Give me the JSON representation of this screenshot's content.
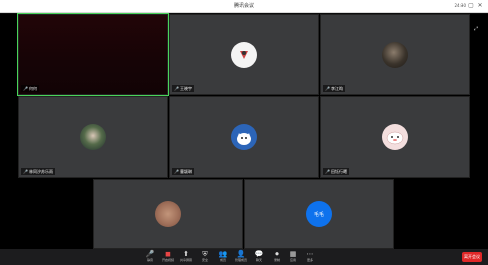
{
  "window": {
    "title": "腾讯会议",
    "time": "24:30",
    "controls": [
      "minimize-icon",
      "maximize-icon",
      "close-icon"
    ]
  },
  "top_right": {
    "view_label": "宫格视图",
    "buttons": [
      "layout-icon",
      "fullscreen-icon"
    ]
  },
  "participants": [
    {
      "name": "何何",
      "mic": "on",
      "avatar": "video",
      "speaking": true
    },
    {
      "name": "王晓宇",
      "mic": "on",
      "avatar": "white-logo"
    },
    {
      "name": "李江昀",
      "mic": "on",
      "avatar": "dark-photo"
    },
    {
      "name": "林同汐苏乐雨",
      "mic": "on",
      "avatar": "green-photo"
    },
    {
      "name": "曹颖琳",
      "mic": "on",
      "avatar": "blue-cartoon"
    },
    {
      "name": "田钰行曦",
      "mic": "off",
      "avatar": "pink-cartoon"
    },
    {
      "name": "",
      "mic": "on",
      "avatar": "tan-photo"
    },
    {
      "name": "",
      "mic": "on",
      "avatar": "initials",
      "initials": "毛毛"
    }
  ],
  "toolbar": {
    "buttons": [
      {
        "icon": "microphone-icon",
        "label": "静音"
      },
      {
        "icon": "camera-icon",
        "label": "开启视频"
      },
      {
        "icon": "share-screen-icon",
        "label": "共享屏幕"
      },
      {
        "icon": "security-icon",
        "label": "安全"
      },
      {
        "icon": "participants-icon",
        "label": "成员"
      },
      {
        "icon": "manage-icon",
        "label": "管理成员"
      },
      {
        "icon": "chat-icon",
        "label": "聊天"
      },
      {
        "icon": "record-icon",
        "label": "录制"
      },
      {
        "icon": "apps-icon",
        "label": "应用"
      },
      {
        "icon": "more-icon",
        "label": "更多"
      }
    ],
    "end_label": "离开会议"
  }
}
